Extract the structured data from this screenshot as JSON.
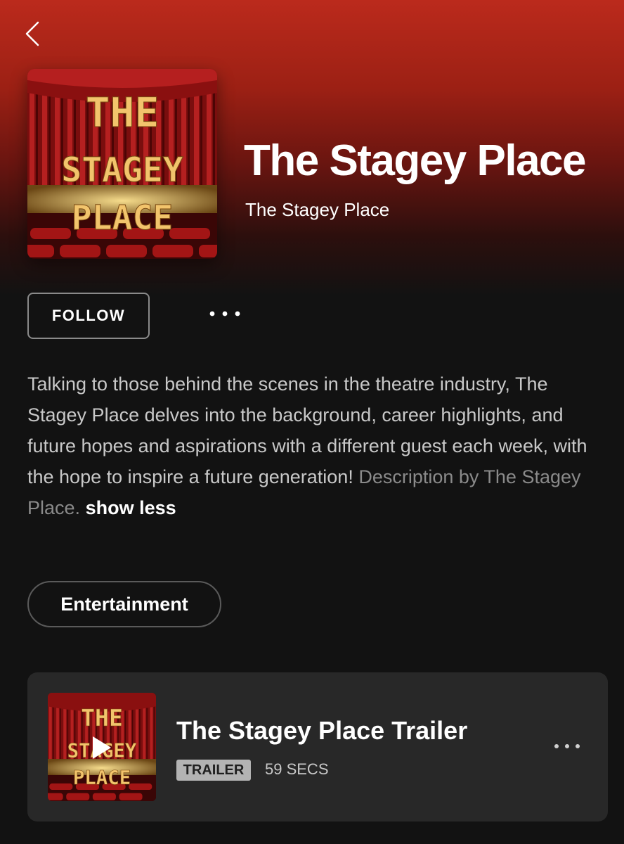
{
  "header": {
    "back_icon": "chevron-left-icon"
  },
  "podcast": {
    "cover_art_text": [
      "THE",
      "STAGEY",
      "PLACE"
    ],
    "title": "The Stagey Place",
    "author": "The Stagey Place",
    "follow_label": "FOLLOW",
    "more_icon": "more-horizontal-icon",
    "description": {
      "main": "Talking to those behind the scenes in the theatre industry, The Stagey Place delves into the background, career highlights, and future hopes and aspirations with a different guest each week, with the hope to inspire a future generation!",
      "credit": "Description by The Stagey Place.",
      "toggle": "show less"
    },
    "category": "Entertainment"
  },
  "episode": {
    "title": "The Stagey Place Trailer",
    "badge": "TRAILER",
    "duration": "59 SECS",
    "play_icon": "play-icon",
    "more_icon": "more-horizontal-icon"
  },
  "colors": {
    "hero_red": "#bb2a1c",
    "background": "#121212",
    "card": "#282828",
    "marquee_gold": "#f0c070"
  }
}
